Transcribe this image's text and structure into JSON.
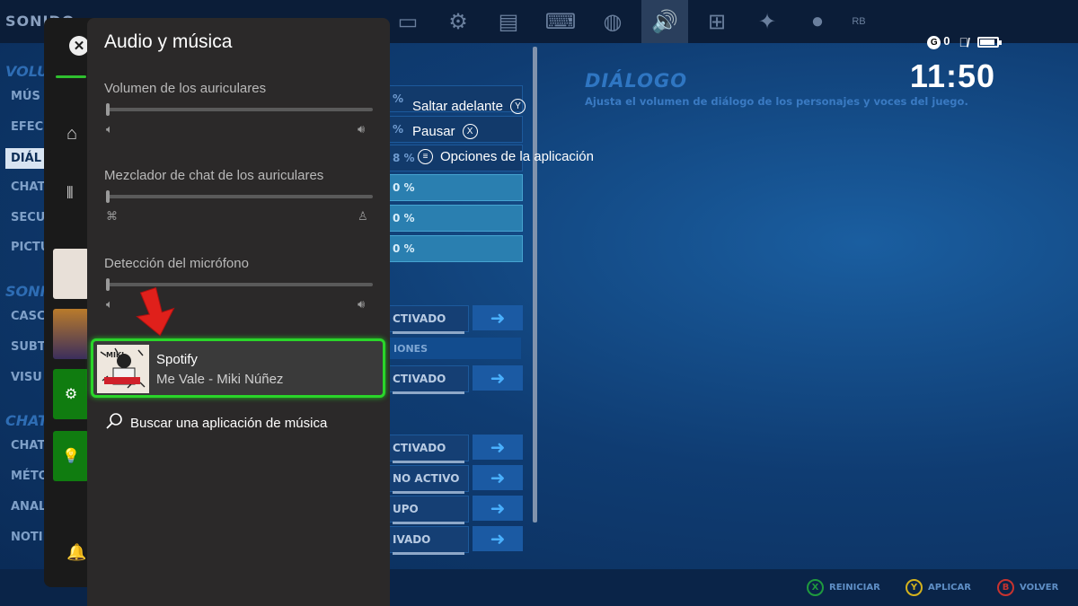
{
  "game": {
    "top_label": "SONIDO",
    "sidebar": [
      {
        "type": "cat",
        "label": "VOLU"
      },
      {
        "type": "item",
        "label": "MÚS"
      },
      {
        "type": "item",
        "label": "EFEC"
      },
      {
        "type": "item",
        "label": "DIÁL",
        "active": true
      },
      {
        "type": "item",
        "label": "CHAT"
      },
      {
        "type": "item",
        "label": "SECU"
      },
      {
        "type": "item",
        "label": "PICTU"
      },
      {
        "type": "cat",
        "label": "SONI"
      },
      {
        "type": "item",
        "label": "CASC"
      },
      {
        "type": "item",
        "label": "SUBT"
      },
      {
        "type": "item",
        "label": "VISU"
      },
      {
        "type": "cat",
        "label": "CHAT"
      },
      {
        "type": "item",
        "label": "CHAT"
      },
      {
        "type": "item",
        "label": "MÉTO"
      },
      {
        "type": "item",
        "label": "ANAL"
      },
      {
        "type": "item",
        "label": "NOTI"
      }
    ],
    "rows": [
      {
        "text": "%",
        "style": "pct-dark"
      },
      {
        "text": "%",
        "style": "pct-dark"
      },
      {
        "text": "8 %",
        "style": "pct-dark"
      },
      {
        "text": "0 %",
        "style": "pct"
      },
      {
        "text": "0 %",
        "style": "pct"
      },
      {
        "text": "0 %",
        "style": "pct"
      },
      {
        "text": "CTIVADO",
        "style": "option"
      },
      {
        "text": "IONES",
        "style": "section"
      },
      {
        "text": "CTIVADO",
        "style": "option"
      },
      {
        "text": "CTIVADO",
        "style": "option"
      },
      {
        "text": "NO ACTIVO",
        "style": "option"
      },
      {
        "text": "UPO",
        "style": "option"
      },
      {
        "text": "IVADO",
        "style": "option"
      }
    ],
    "detail": {
      "title": "DIÁLOGO",
      "description": "Ajusta el volumen de diálogo de los personajes y voces del juego."
    },
    "footer_hints": [
      {
        "button": "X",
        "label": "REINICIAR",
        "color": "#1f9a3e"
      },
      {
        "button": "Y",
        "label": "APLICAR",
        "color": "#d4b21d"
      },
      {
        "button": "B",
        "label": "VOLVER",
        "color": "#c8332f"
      }
    ]
  },
  "status": {
    "gamerscore": "0",
    "time": "11:50"
  },
  "media_controls": [
    {
      "label": "Saltar adelante",
      "button": "Y"
    },
    {
      "label": "Pausar",
      "button": "X"
    },
    {
      "label": "Opciones de la aplicación",
      "button": "≡"
    }
  ],
  "guide": {
    "panel_title": "Audio y música",
    "sliders": [
      {
        "label": "Volumen de los auriculares",
        "level": 0.0,
        "left_icon": "speaker-low-icon",
        "right_icon": "speaker-high-icon"
      },
      {
        "label": "Mezclador de chat de los auriculares",
        "level": 0.0,
        "left_icon": "controller-icon",
        "right_icon": "person-icon"
      },
      {
        "label": "Detección del micrófono",
        "level": 0.0,
        "left_icon": "speaker-low-icon",
        "right_icon": "speaker-high-icon"
      }
    ],
    "now_playing": {
      "app": "Spotify",
      "track": "Me Vale - Miki Núñez"
    },
    "search_label": "Buscar una aplicación de música"
  },
  "colors": {
    "focus_green": "#2ad52a",
    "xbox_green": "#107c10",
    "arrow_red": "#e0201b"
  }
}
